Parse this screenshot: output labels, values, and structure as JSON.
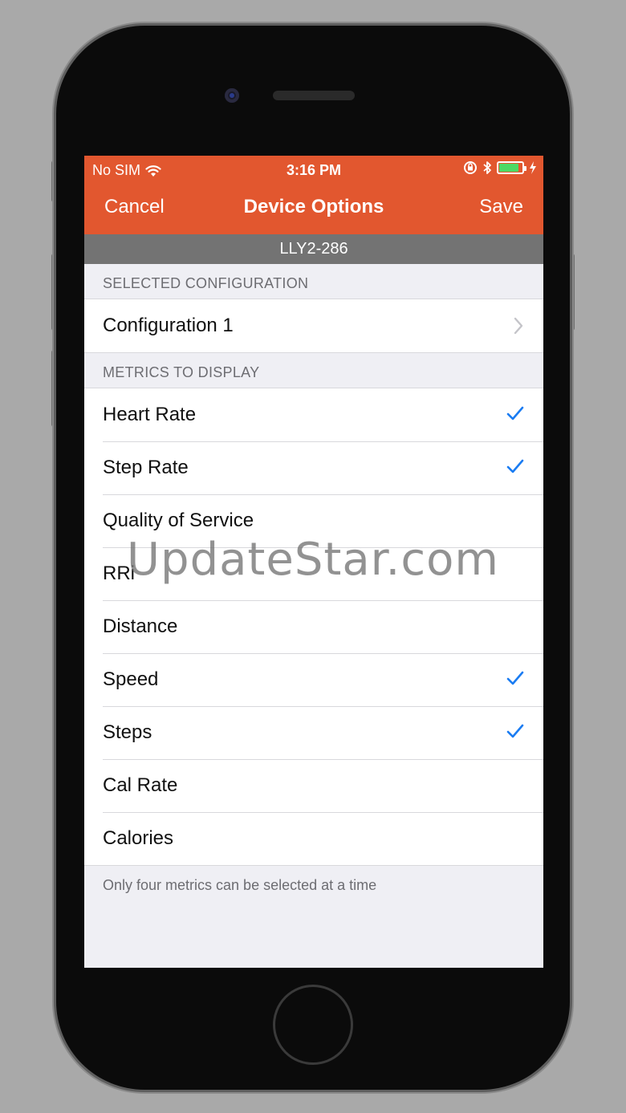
{
  "status_bar": {
    "carrier": "No SIM",
    "time": "3:16 PM"
  },
  "nav": {
    "cancel_label": "Cancel",
    "title": "Device Options",
    "save_label": "Save"
  },
  "device_name": "LLY2-286",
  "selected_configuration": {
    "header": "SELECTED CONFIGURATION",
    "value": "Configuration 1"
  },
  "metrics": {
    "header": "METRICS TO DISPLAY",
    "items": [
      {
        "label": "Heart Rate",
        "checked": true
      },
      {
        "label": "Step Rate",
        "checked": true
      },
      {
        "label": "Quality of Service",
        "checked": false
      },
      {
        "label": "RRi",
        "checked": false
      },
      {
        "label": "Distance",
        "checked": false
      },
      {
        "label": "Speed",
        "checked": true
      },
      {
        "label": "Steps",
        "checked": true
      },
      {
        "label": "Cal Rate",
        "checked": false
      },
      {
        "label": "Calories",
        "checked": false
      }
    ],
    "footer": "Only four metrics can be selected at a time"
  },
  "battery_level": 0.85,
  "colors": {
    "accent": "#e2572f",
    "check": "#1a7cf2",
    "battery": "#4cd964"
  },
  "watermark": "UpdateStar.com"
}
